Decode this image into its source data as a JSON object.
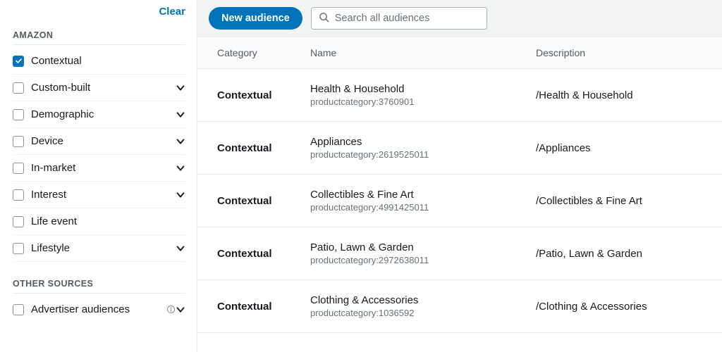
{
  "sidebar": {
    "clear_label": "Clear",
    "sections": [
      {
        "title": "AMAZON",
        "items": [
          {
            "label": "Contextual",
            "checked": true,
            "expandable": false
          },
          {
            "label": "Custom-built",
            "checked": false,
            "expandable": true
          },
          {
            "label": "Demographic",
            "checked": false,
            "expandable": true
          },
          {
            "label": "Device",
            "checked": false,
            "expandable": true
          },
          {
            "label": "In-market",
            "checked": false,
            "expandable": true
          },
          {
            "label": "Interest",
            "checked": false,
            "expandable": true
          },
          {
            "label": "Life event",
            "checked": false,
            "expandable": false
          },
          {
            "label": "Lifestyle",
            "checked": false,
            "expandable": true
          }
        ]
      },
      {
        "title": "OTHER SOURCES",
        "items": [
          {
            "label": "Advertiser audiences",
            "checked": false,
            "expandable": true,
            "info": true
          }
        ]
      }
    ]
  },
  "toolbar": {
    "new_audience_label": "New audience",
    "search_placeholder": "Search all audiences"
  },
  "table": {
    "headers": {
      "category": "Category",
      "name": "Name",
      "description": "Description"
    },
    "rows": [
      {
        "category": "Contextual",
        "name": "Health & Household",
        "code": "productcategory:3760901",
        "description": "/Health & Household"
      },
      {
        "category": "Contextual",
        "name": "Appliances",
        "code": "productcategory:2619525011",
        "description": "/Appliances"
      },
      {
        "category": "Contextual",
        "name": "Collectibles & Fine Art",
        "code": "productcategory:4991425011",
        "description": "/Collectibles & Fine Art"
      },
      {
        "category": "Contextual",
        "name": "Patio, Lawn & Garden",
        "code": "productcategory:2972638011",
        "description": "/Patio, Lawn & Garden"
      },
      {
        "category": "Contextual",
        "name": "Clothing & Accessories",
        "code": "productcategory:1036592",
        "description": "/Clothing & Accessories"
      }
    ]
  }
}
